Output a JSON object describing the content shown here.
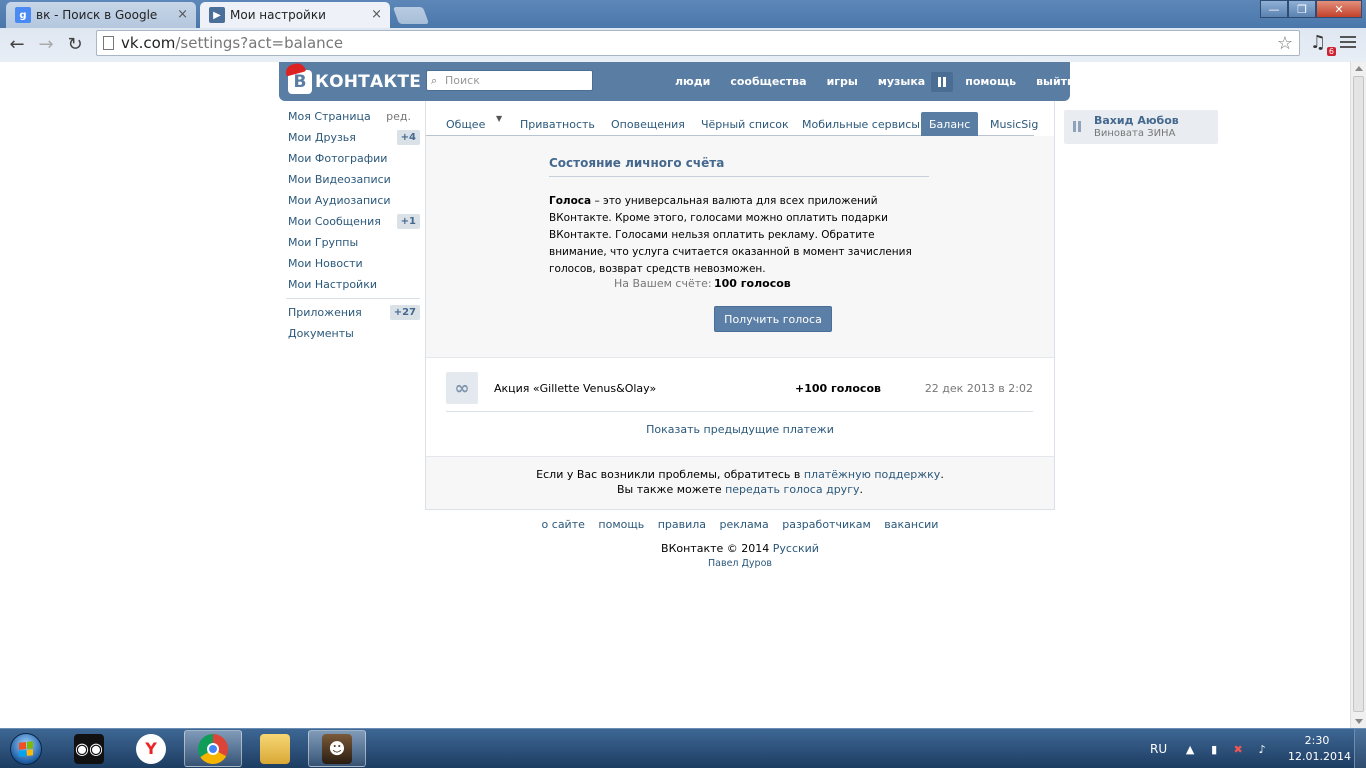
{
  "browser": {
    "tabs": [
      {
        "label": "вк - Поиск в Google",
        "favicon": "google-icon",
        "active": false
      },
      {
        "label": "Мои настройки",
        "favicon": "vk-play-icon",
        "active": true
      }
    ],
    "url_host": "vk.com",
    "url_path": "/settings?act=balance",
    "extension_badge": "6"
  },
  "vk": {
    "logo_text": "КОНТАКТЕ",
    "logo_letter": "В",
    "search_placeholder": "Поиск",
    "nav": [
      "люди",
      "сообщества",
      "игры",
      "музыка",
      "помощь",
      "выйти"
    ],
    "left_menu": [
      {
        "label": "Моя Страница",
        "extra": "ред."
      },
      {
        "label": "Мои Друзья",
        "count": "+4"
      },
      {
        "label": "Мои Фотографии"
      },
      {
        "label": "Мои Видеозаписи"
      },
      {
        "label": "Мои Аудиозаписи"
      },
      {
        "label": "Мои Сообщения",
        "count": "+1"
      },
      {
        "label": "Мои Группы"
      },
      {
        "label": "Мои Новости"
      },
      {
        "label": "Мои Настройки"
      }
    ],
    "left_menu_secondary": [
      {
        "label": "Приложения",
        "count": "+27"
      },
      {
        "label": "Документы"
      }
    ],
    "settings_tabs": [
      "Общее",
      "Приватность",
      "Оповещения",
      "Чёрный список",
      "Мобильные сервисы",
      "Баланс",
      "MusicSig"
    ],
    "active_tab": "Баланс",
    "balance": {
      "title": "Состояние личного счёта",
      "desc_bold": "Голоса",
      "desc_rest": " – это универсальная валюта для всех приложений ВКонтакте. Кроме этого, голосами можно оплатить подарки ВКонтакте. Голосами нельзя оплатить рекламу. Обратите внимание, что услуга считается оказанной в момент зачисления голосов, возврат средств невозможен.",
      "account_label": "На Вашем счёте:",
      "account_value": "100 голосов",
      "get_button": "Получить голоса"
    },
    "history": [
      {
        "name": "Акция «Gillette Venus&Olay»",
        "amount": "+100 голосов",
        "date": "22 дек 2013 в 2:02"
      }
    ],
    "show_previous": "Показать предыдущие платежи",
    "help": {
      "line1_pre": "Если у Вас возникли проблемы, обратитесь в ",
      "line1_link": "платёжную поддержку",
      "line1_post": ".",
      "line2_pre": "Вы также можете ",
      "line2_link": "передать голоса другу",
      "line2_post": "."
    },
    "footer_links": [
      "о сайте",
      "помощь",
      "правила",
      "реклама",
      "разработчикам",
      "вакансии"
    ],
    "footer_copy": "ВКонтакте © 2014",
    "footer_lang": "Русский",
    "footer_author": "Павел Дуров",
    "audio": {
      "artist": "Вахид Аюбов",
      "song": "Виновата ЗИНА"
    }
  },
  "taskbar": {
    "language": "RU",
    "time": "2:30",
    "date": "12.01.2014"
  }
}
